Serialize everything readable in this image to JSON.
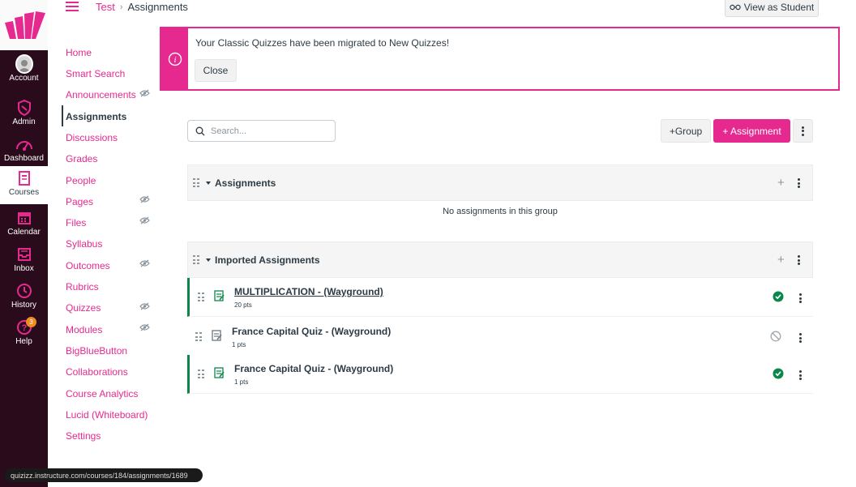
{
  "global_nav": {
    "items": [
      {
        "label": "Account",
        "icon": "account-avatar-icon"
      },
      {
        "label": "Admin",
        "icon": "shield-icon"
      },
      {
        "label": "Dashboard",
        "icon": "dashboard-gauge-icon"
      },
      {
        "label": "Courses",
        "icon": "book-icon",
        "active": true
      },
      {
        "label": "Calendar",
        "icon": "calendar-icon"
      },
      {
        "label": "Inbox",
        "icon": "inbox-icon"
      },
      {
        "label": "History",
        "icon": "clock-icon"
      },
      {
        "label": "Help",
        "icon": "help-icon",
        "badge": "3"
      }
    ]
  },
  "breadcrumb": {
    "course": "Test",
    "separator": "›",
    "current": "Assignments"
  },
  "header": {
    "view_as_student": "View as Student",
    "view_as_student_icon": "glasses-icon"
  },
  "course_nav": {
    "items": [
      {
        "label": "Home"
      },
      {
        "label": "Smart Search"
      },
      {
        "label": "Announcements",
        "hidden": true
      },
      {
        "label": "Assignments",
        "active": true
      },
      {
        "label": "Discussions"
      },
      {
        "label": "Grades"
      },
      {
        "label": "People"
      },
      {
        "label": "Pages",
        "hidden": true
      },
      {
        "label": "Files",
        "hidden": true
      },
      {
        "label": "Syllabus"
      },
      {
        "label": "Outcomes",
        "hidden": true
      },
      {
        "label": "Rubrics"
      },
      {
        "label": "Quizzes",
        "hidden": true
      },
      {
        "label": "Modules",
        "hidden": true
      },
      {
        "label": "BigBlueButton"
      },
      {
        "label": "Collaborations"
      },
      {
        "label": "Course Analytics"
      },
      {
        "label": "Lucid (Whiteboard)"
      },
      {
        "label": "Settings"
      }
    ]
  },
  "alert": {
    "message": "Your Classic Quizzes have been migrated to New Quizzes!",
    "close_label": "Close",
    "icon": "info-icon"
  },
  "toolbar": {
    "search_placeholder": "Search...",
    "group_label": "+Group",
    "assignment_label": "+ Assignment"
  },
  "groups": [
    {
      "title": "Assignments",
      "empty_message": "No assignments in this group",
      "assignments": []
    },
    {
      "title": "Imported Assignments",
      "assignments": [
        {
          "title": "MULTIPLICATION - (Wayground)",
          "points": "20 pts",
          "published": true
        },
        {
          "title": "France Capital Quiz - (Wayground)",
          "points": "1 pts",
          "published": false
        },
        {
          "title": "France Capital Quiz - (Wayground)",
          "points": "1 pts",
          "published": true
        }
      ]
    }
  ],
  "status_bar": {
    "url": "quizizz.instructure.com/courses/184/assignments/1689"
  },
  "colors": {
    "brand": "#e6298f",
    "nav_bg": "#2a0b1b",
    "published": "#0b874b",
    "text": "#2d3b45"
  }
}
